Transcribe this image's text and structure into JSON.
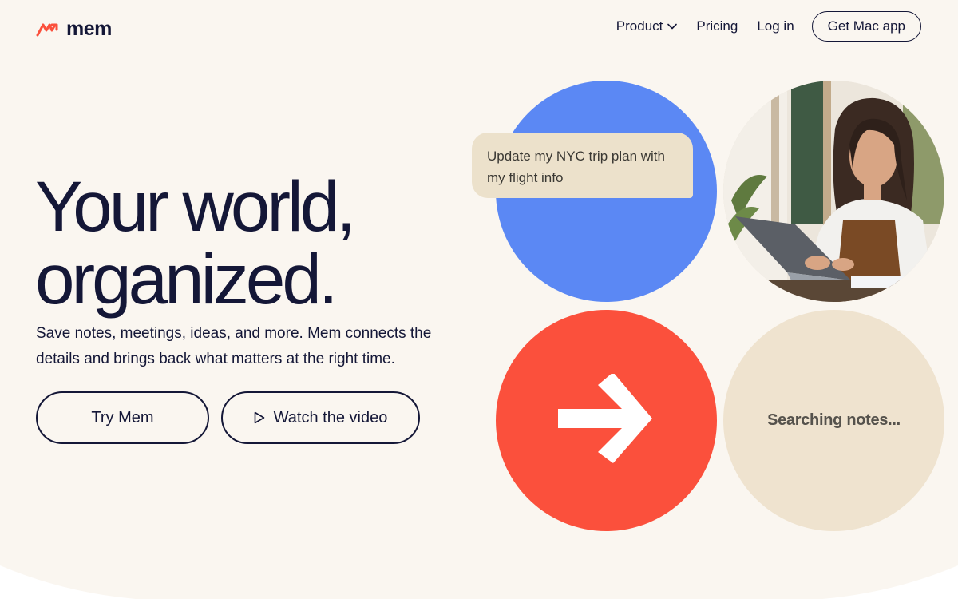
{
  "brand": {
    "name": "mem",
    "mark_icon": "mem-logo-icon",
    "accent": "#fb503c"
  },
  "nav": {
    "product_label": "Product",
    "product_icon": "chevron-down-icon",
    "pricing_label": "Pricing",
    "login_label": "Log in",
    "cta_label": "Get Mac app"
  },
  "hero": {
    "title_line1": "Your world,",
    "title_line2": "organized.",
    "subtitle": "Save notes, meetings, ideas, and more. Mem connects the details and brings back what matters at the right time.",
    "primary_button": "Try Mem",
    "secondary_button": "Watch the video",
    "secondary_icon": "play-icon"
  },
  "visual": {
    "chat_bubble": "Update my NYC trip plan with my flight info",
    "arrow_icon": "arrow-right-icon",
    "status_text": "Searching notes...",
    "photo": "person-laptop-photo",
    "colors": {
      "blue": "#5b88f4",
      "red": "#fb503c",
      "beige": "#efe3cf",
      "background": "#faf6f0",
      "ink": "#141737"
    }
  }
}
